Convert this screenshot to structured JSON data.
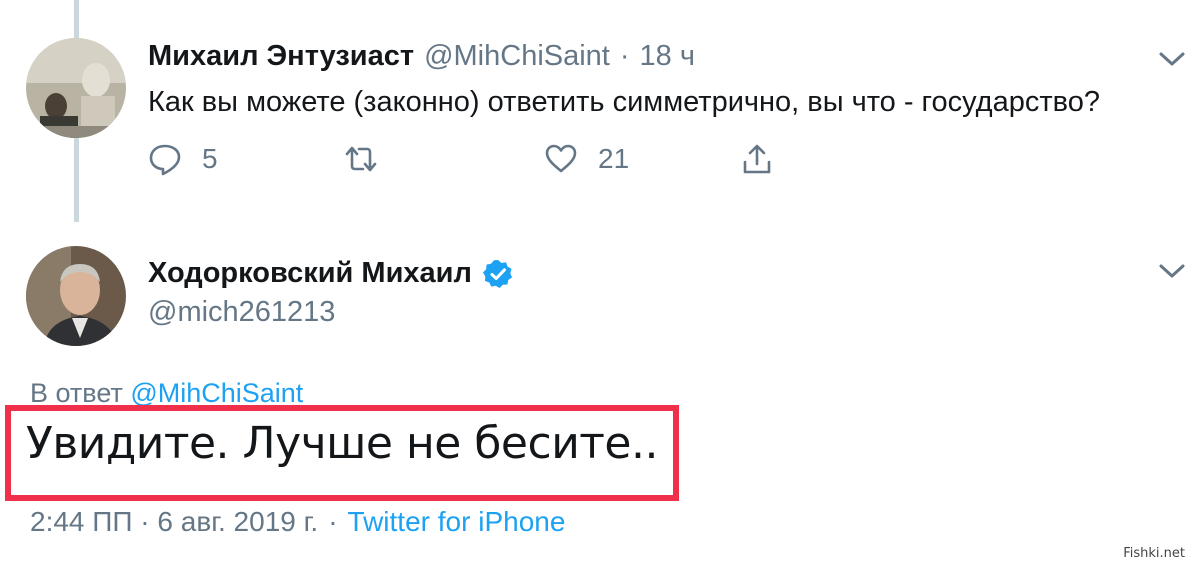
{
  "tweet1": {
    "name": "Михаил Энтузиаст",
    "handle": "@MihChiSaint",
    "dot": "·",
    "time": "18 ч",
    "text": "Как вы можете (законно) ответить симметрично, вы что - государство?",
    "reply_count": "5",
    "like_count": "21"
  },
  "tweet2": {
    "name": "Ходорковский Михаил",
    "handle": "@mich261213",
    "reply_prefix": "В ответ",
    "reply_link": "@MihChiSaint",
    "text": "Увидите. Лучше не бесите..",
    "timestamp": "2:44 ПП · 6 авг. 2019 г.",
    "sep": "·",
    "source": "Twitter for iPhone"
  },
  "colors": {
    "accent": "#1da1f2",
    "highlight": "#f0304a",
    "muted": "#657786"
  },
  "watermark": "Fishki.net"
}
